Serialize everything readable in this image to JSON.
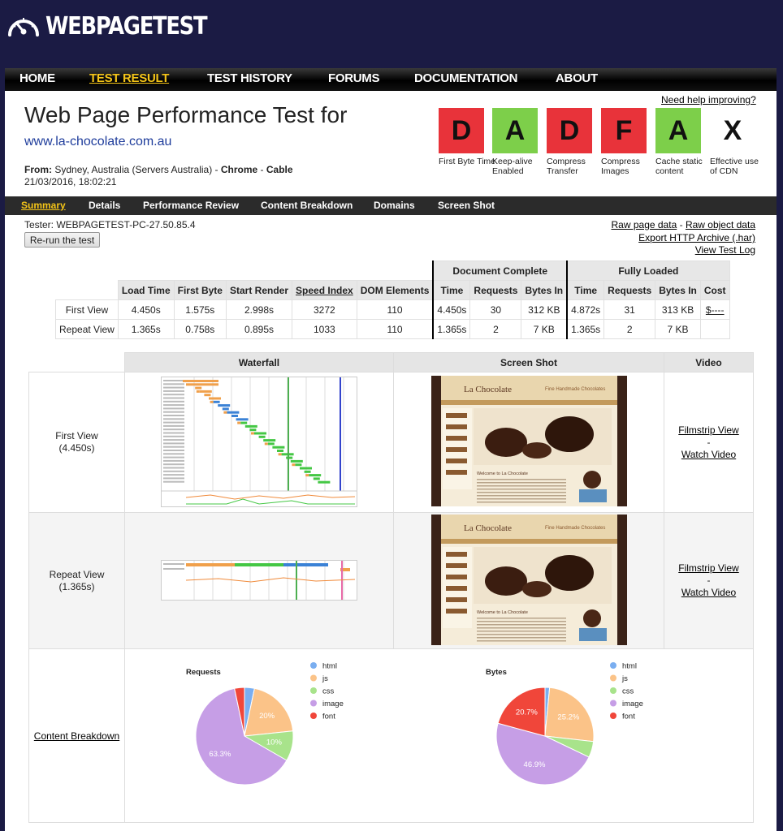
{
  "header": {
    "logo_text": "WEBPAGETEST",
    "nav": [
      "HOME",
      "TEST RESULT",
      "TEST HISTORY",
      "FORUMS",
      "DOCUMENTATION",
      "ABOUT"
    ]
  },
  "test": {
    "title": "Web Page Performance Test for",
    "url": "www.la-chocolate.com.au",
    "from_label": "From:",
    "from_location": "Sydney, Australia (Servers Australia)",
    "browser": "Chrome",
    "connection": "Cable",
    "date": "21/03/2016, 18:02:21",
    "help_link": "Need help improving?"
  },
  "grades": [
    {
      "letter": "D",
      "label": "First Byte Time",
      "color": "#e8333a"
    },
    {
      "letter": "A",
      "label": "Keep-alive Enabled",
      "color": "#7dcf4a"
    },
    {
      "letter": "D",
      "label": "Compress Transfer",
      "color": "#e8333a"
    },
    {
      "letter": "F",
      "label": "Compress Images",
      "color": "#e8333a"
    },
    {
      "letter": "A",
      "label": "Cache static content",
      "color": "#7dcf4a"
    },
    {
      "letter": "X",
      "label": "Effective use of CDN",
      "color": "#ffffff"
    }
  ],
  "subnav": [
    "Summary",
    "Details",
    "Performance Review",
    "Content Breakdown",
    "Domains",
    "Screen Shot"
  ],
  "tester": "Tester: WEBPAGETEST-PC-27.50.85.4",
  "rerun_label": "Re-run the test",
  "links": {
    "raw_page": "Raw page data",
    "sep": "-",
    "raw_object": "Raw object data",
    "export_har": "Export HTTP Archive (.har)",
    "test_log": "View Test Log"
  },
  "metrics": {
    "group_doc": "Document Complete",
    "group_full": "Fully Loaded",
    "headers": [
      "Load Time",
      "First Byte",
      "Start Render",
      "Speed Index",
      "DOM Elements",
      "Time",
      "Requests",
      "Bytes In",
      "Time",
      "Requests",
      "Bytes In",
      "Cost"
    ],
    "rows": [
      {
        "label": "First View",
        "cells": [
          "4.450s",
          "1.575s",
          "2.998s",
          "3272",
          "110",
          "4.450s",
          "30",
          "312 KB",
          "4.872s",
          "31",
          "313 KB",
          "$----"
        ]
      },
      {
        "label": "Repeat View",
        "cells": [
          "1.365s",
          "0.758s",
          "0.895s",
          "1033",
          "110",
          "1.365s",
          "2",
          "7 KB",
          "1.365s",
          "2",
          "7 KB",
          ""
        ]
      }
    ]
  },
  "results": {
    "headers": [
      "Waterfall",
      "Screen Shot",
      "Video"
    ],
    "first_view": {
      "label": "First View",
      "time": "(4.450s)"
    },
    "repeat_view": {
      "label": "Repeat View",
      "time": "(1.365s)"
    },
    "filmstrip": "Filmstrip View",
    "dash": "-",
    "watch": "Watch Video",
    "content_breakdown": "Content Breakdown",
    "shot_logo": "La Chocolate",
    "shot_tagline": "Fine Handmade Chocolates",
    "shot_welcome": "Welcome to La Chocolate"
  },
  "pie_legend": [
    {
      "name": "html",
      "color": "#7aaef0"
    },
    {
      "name": "js",
      "color": "#fbc388"
    },
    {
      "name": "css",
      "color": "#a8e38b"
    },
    {
      "name": "image",
      "color": "#c69ee6"
    },
    {
      "name": "font",
      "color": "#f0463a"
    }
  ],
  "chart_data": [
    {
      "type": "pie",
      "title": "Requests",
      "categories": [
        "html",
        "js",
        "css",
        "image",
        "font"
      ],
      "values": [
        3.3,
        20,
        10,
        63.3,
        3.3
      ],
      "labels": [
        "",
        "20%",
        "10%",
        "63.3%",
        ""
      ]
    },
    {
      "type": "pie",
      "title": "Bytes",
      "categories": [
        "html",
        "js",
        "css",
        "image",
        "font"
      ],
      "values": [
        1.5,
        25.2,
        5.3,
        46.9,
        20.7
      ],
      "labels": [
        "",
        "25.2%",
        "",
        "46.9%",
        "20.7%"
      ]
    }
  ]
}
